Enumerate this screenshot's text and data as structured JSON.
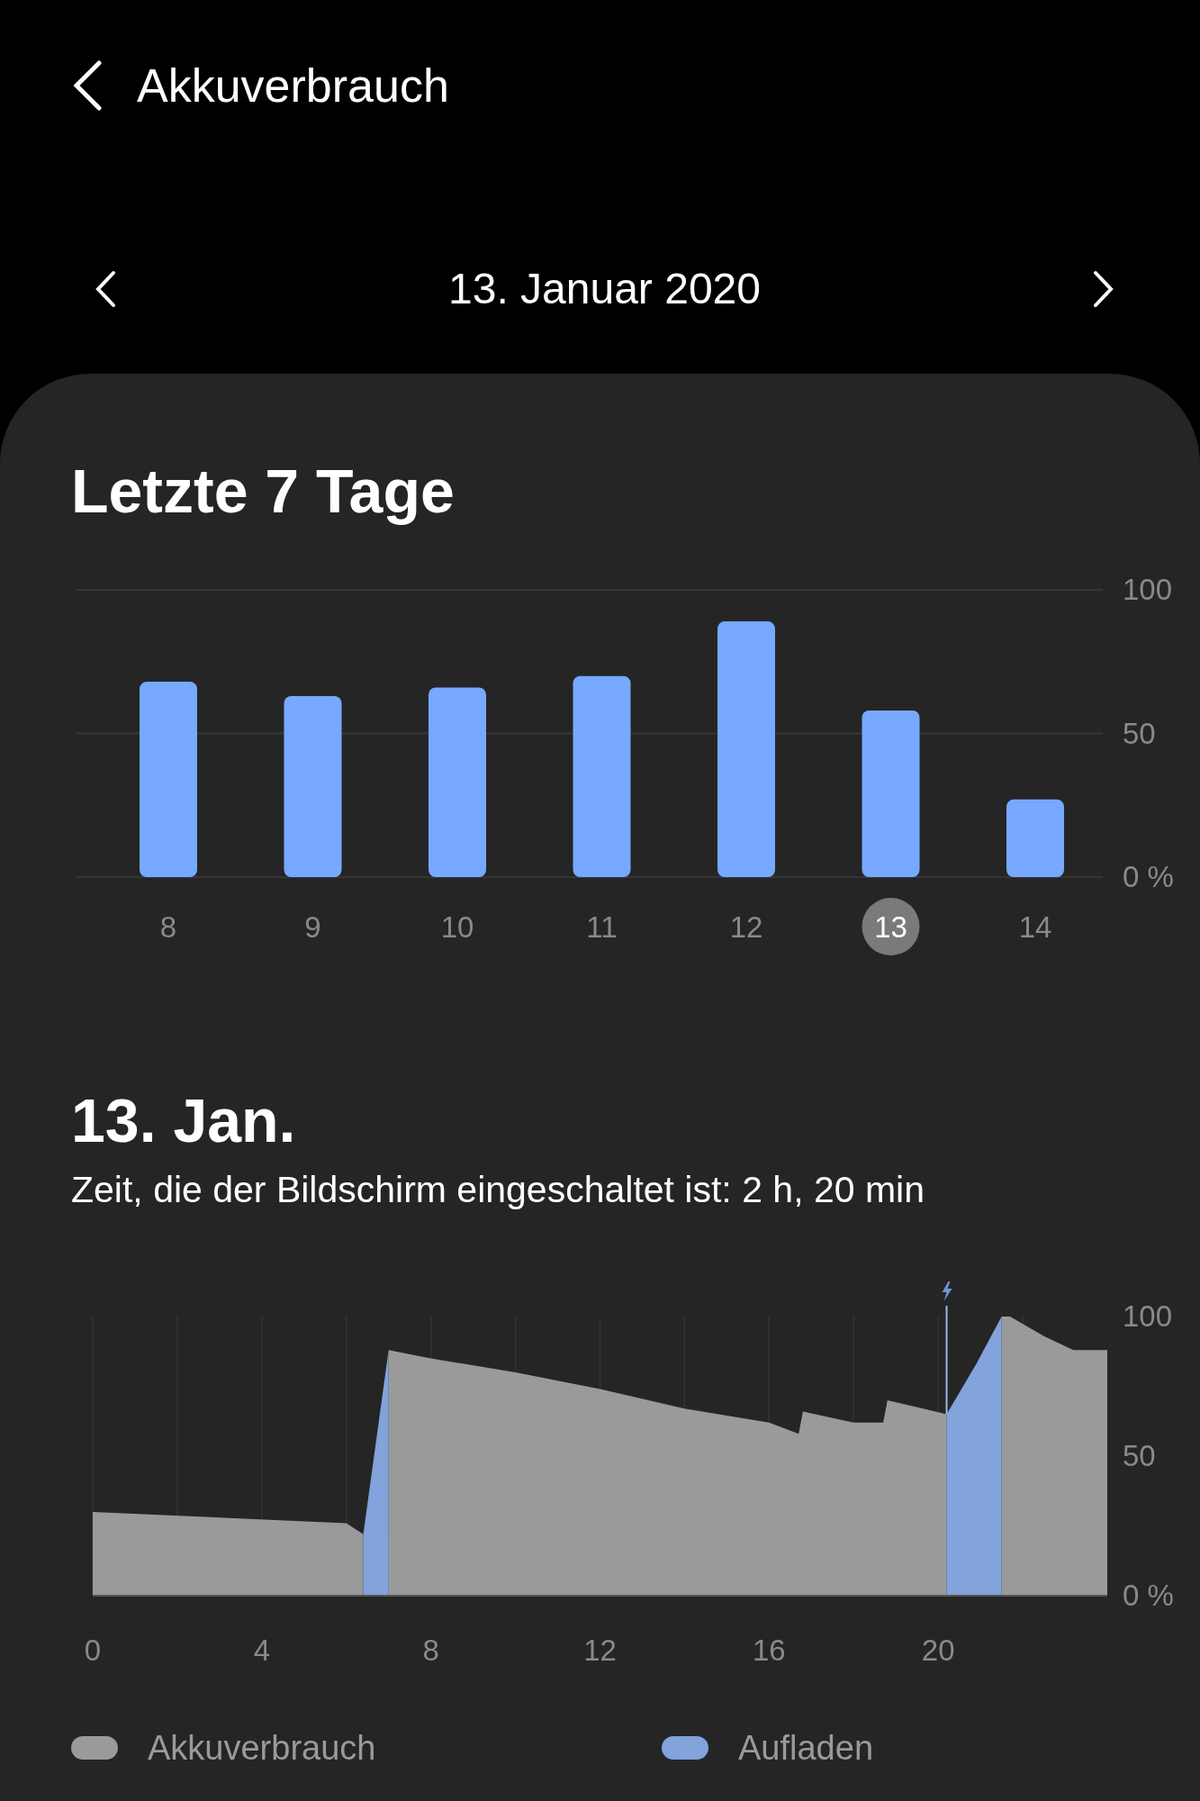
{
  "header": {
    "title": "Akkuverbrauch"
  },
  "date_nav": {
    "date": "13. Januar 2020"
  },
  "weekly": {
    "title": "Letzte 7 Tage",
    "day_states": [
      {
        "selected": false
      },
      {
        "selected": false
      },
      {
        "selected": false
      },
      {
        "selected": false
      },
      {
        "selected": false
      },
      {
        "selected": true
      },
      {
        "selected": false
      }
    ],
    "chart_data": {
      "type": "bar",
      "categories": [
        "8",
        "9",
        "10",
        "11",
        "12",
        "13",
        "14"
      ],
      "series": [
        {
          "color": "#76a9ff",
          "values": [
            68,
            63,
            66,
            70,
            89,
            58,
            27
          ]
        }
      ],
      "ylim": [
        0,
        100
      ],
      "grid": true,
      "yticks": [
        {
          "value": 0,
          "label": "0 %"
        },
        {
          "value": 50,
          "label": "50"
        },
        {
          "value": 100,
          "label": "100"
        }
      ]
    }
  },
  "daily": {
    "title": "13. Jan.",
    "subtitle": "Zeit, die der Bildschirm eingeschaltet ist: 2 h, 20 min",
    "chart_data": {
      "type": "area",
      "x": [
        0,
        6,
        6.4,
        6.7,
        7,
        8,
        10,
        12,
        14,
        16,
        16.7,
        16.8,
        18,
        18.7,
        18.8,
        20.2,
        20.9,
        21.5,
        21.7,
        22.5,
        23.2,
        24
      ],
      "series": [
        {
          "name": "Akkuverbrauch",
          "color": "#9a9a9a",
          "values": [
            30,
            26,
            22,
            null,
            88,
            85,
            80,
            74,
            67,
            62,
            58,
            66,
            62,
            62,
            70,
            65,
            null,
            100,
            100,
            93,
            88,
            88
          ]
        },
        {
          "name": "Aufladen",
          "color": "#82a3db",
          "values": [
            null,
            null,
            22,
            55,
            88,
            null,
            null,
            null,
            null,
            null,
            null,
            null,
            null,
            null,
            null,
            65,
            83,
            100,
            null,
            null,
            null,
            null
          ]
        }
      ],
      "xlim": [
        0,
        24
      ],
      "ylim": [
        0,
        100
      ],
      "grid": true,
      "xticks": [
        0,
        4,
        8,
        12,
        16,
        20
      ],
      "yticks": [
        {
          "value": 0,
          "label": "0 %"
        },
        {
          "value": 50,
          "label": "50"
        },
        {
          "value": 100,
          "label": "100"
        }
      ]
    }
  }
}
